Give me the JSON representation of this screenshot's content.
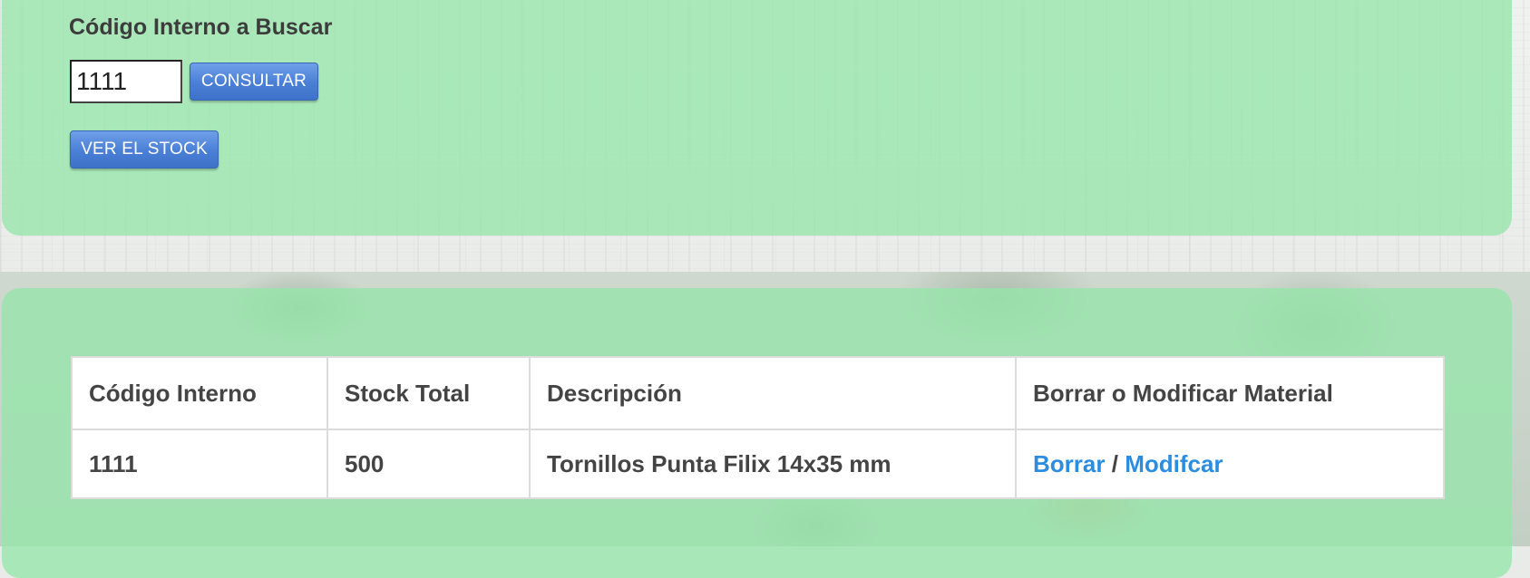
{
  "search": {
    "title": "Código Interno a Buscar",
    "input_value": "1111",
    "consult_button": "CONSULTAR",
    "stock_button": "VER EL STOCK"
  },
  "table": {
    "headers": {
      "code": "Código Interno",
      "stock": "Stock Total",
      "description": "Descripción",
      "actions": "Borrar o Modificar Material"
    },
    "rows": [
      {
        "code": "1111",
        "stock": "500",
        "description": "Tornillos Punta Filix 14x35 mm",
        "delete_label": "Borrar",
        "separator": "/",
        "modify_label": "Modifcar"
      }
    ]
  },
  "colors": {
    "panel_green": "#96e6aa",
    "button_blue": "#4a7fd6",
    "link_blue": "#2b8de0",
    "text_dark": "#444444"
  }
}
